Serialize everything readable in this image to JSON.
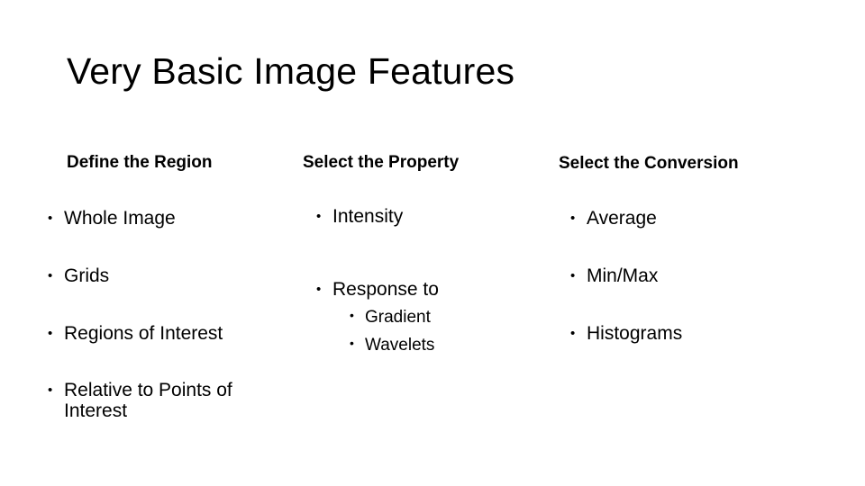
{
  "slide": {
    "title": "Very Basic Image Features",
    "columns": [
      {
        "heading": "Define the Region",
        "items": [
          "Whole Image",
          "Grids",
          "Regions of Interest",
          "Relative to Points of",
          "Interest"
        ]
      },
      {
        "heading": "Select the Property",
        "items": [
          "Intensity",
          "Response to"
        ],
        "subitems": [
          "Gradient",
          "Wavelets"
        ]
      },
      {
        "heading": "Select the Conversion",
        "items": [
          "Average",
          "Min/Max",
          "Histograms"
        ]
      }
    ],
    "bullet_glyph": "•"
  }
}
